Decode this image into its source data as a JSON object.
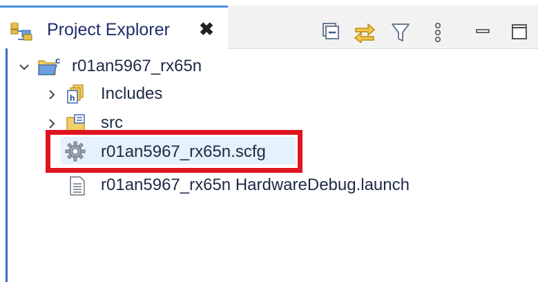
{
  "view": {
    "title": "Project Explorer",
    "close_label": "✖",
    "toolbar": [
      {
        "name": "collapse-all-icon"
      },
      {
        "name": "link-with-editor-icon"
      },
      {
        "name": "filter-icon"
      },
      {
        "name": "view-menu-icon"
      },
      {
        "name": "minimize-icon"
      },
      {
        "name": "maximize-icon"
      }
    ]
  },
  "tree": {
    "project": {
      "label": "r01an5967_rx65n",
      "expanded": true
    },
    "children": [
      {
        "label": "Includes",
        "icon": "includes-folder-icon",
        "expanded": false
      },
      {
        "label": "src",
        "icon": "source-folder-icon",
        "expanded": false
      },
      {
        "label": "r01an5967_rx65n.scfg",
        "icon": "gear-icon",
        "selected": true
      },
      {
        "label": "r01an5967_rx65n HardwareDebug.launch",
        "icon": "file-icon"
      }
    ]
  },
  "colors": {
    "tab_accent": "#4a90e2",
    "selection": "#e5f1fb",
    "highlight_box": "#e0141e"
  }
}
